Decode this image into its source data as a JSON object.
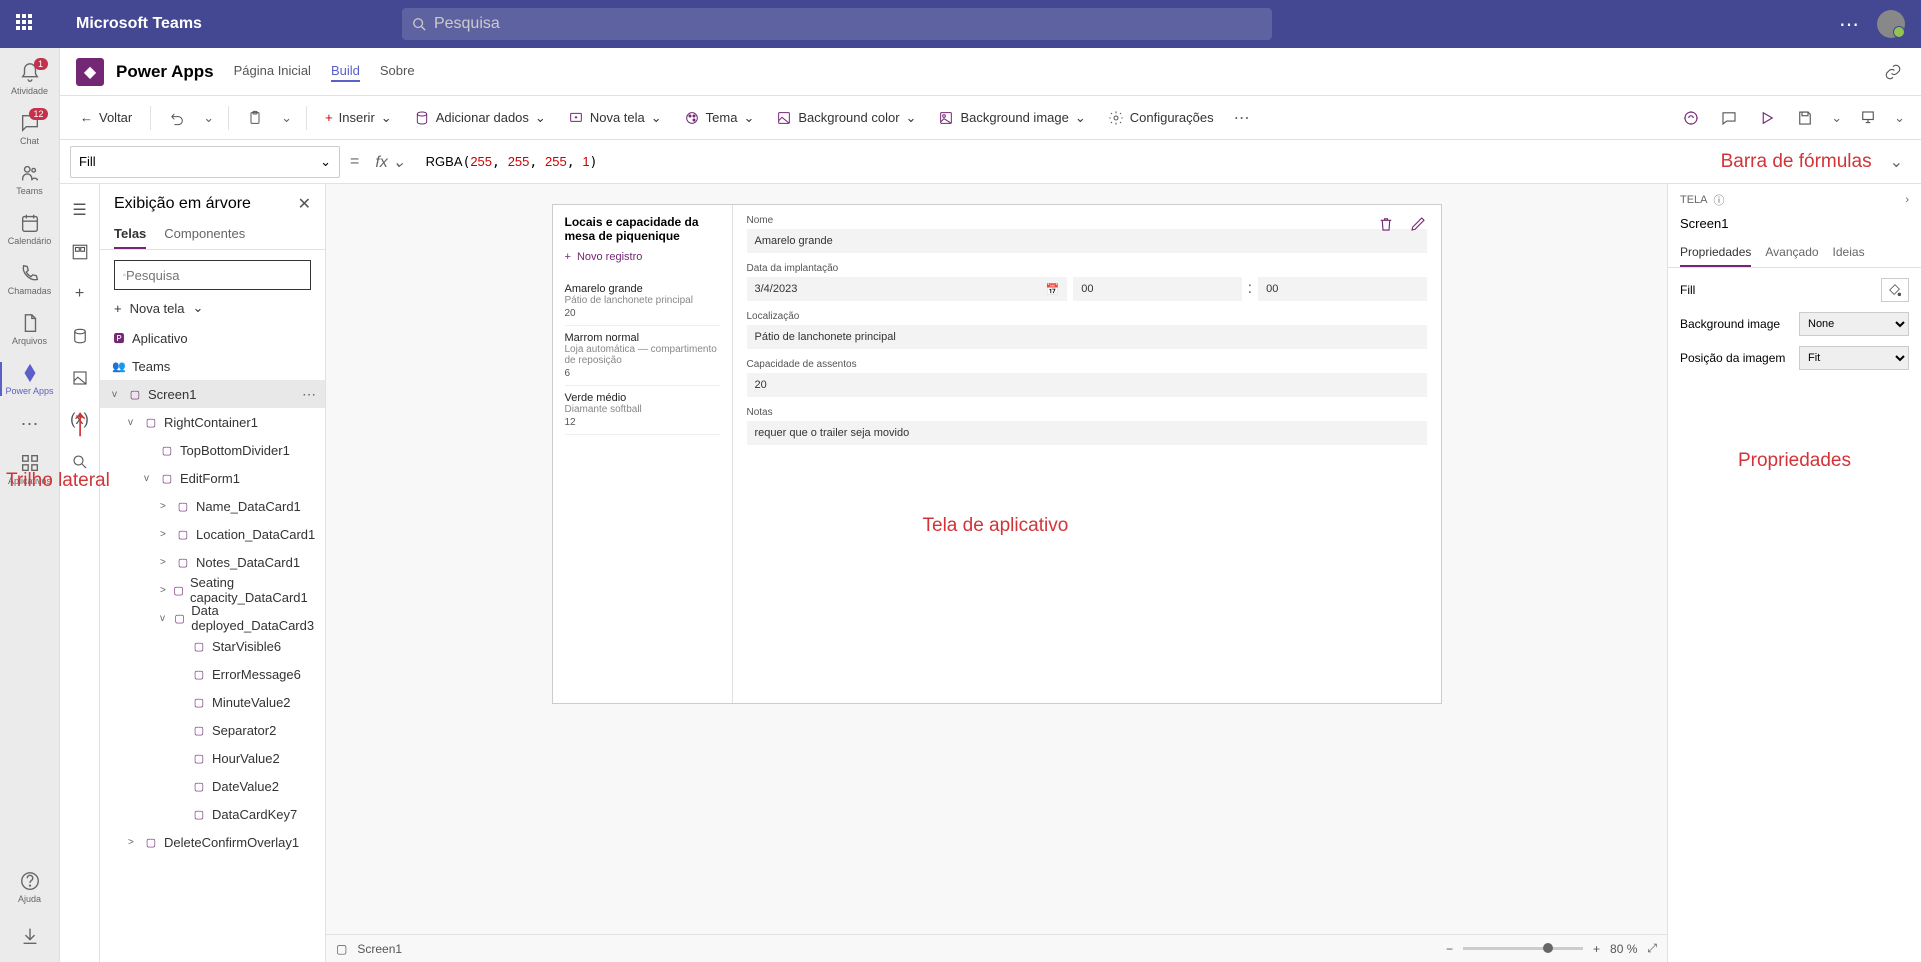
{
  "teams_header": {
    "title": "Microsoft Teams",
    "search_placeholder": "Pesquisa"
  },
  "teams_rail": {
    "items": [
      {
        "label": "Atividade",
        "badge": "1"
      },
      {
        "label": "Chat",
        "badge": "12"
      },
      {
        "label": "Teams"
      },
      {
        "label": "Calendário"
      },
      {
        "label": "Chamadas"
      },
      {
        "label": "Arquivos"
      },
      {
        "label": "Power Apps",
        "active": true
      }
    ],
    "apps": "Aplicativos",
    "help": "Ajuda"
  },
  "app_header": {
    "name": "Power Apps",
    "tabs": [
      {
        "label": "Página Inicial"
      },
      {
        "label": "Build",
        "active": true
      },
      {
        "label": "Sobre"
      }
    ]
  },
  "toolbar": {
    "back": "Voltar",
    "insert": "Inserir",
    "add_data": "Adicionar dados",
    "new_screen": "Nova tela",
    "theme": "Tema",
    "bgcolor": "Background color",
    "bgimage": "Background image",
    "settings": "Configurações"
  },
  "formula_bar": {
    "property": "Fill",
    "fx": "fx",
    "formula_fn": "RGBA",
    "formula_args": "255, 255, 255, 1",
    "annotation": "Barra de fórmulas"
  },
  "tree": {
    "title": "Exibição em árvore",
    "tabs": {
      "screens": "Telas",
      "components": "Componentes"
    },
    "search": "Pesquisa",
    "new_screen": "Nova tela",
    "app": "Aplicativo",
    "teams": "Teams",
    "nodes": [
      {
        "name": "Screen1",
        "level": 0,
        "sel": true,
        "toggle": "v",
        "more": true
      },
      {
        "name": "RightContainer1",
        "level": 1,
        "toggle": "v"
      },
      {
        "name": "TopBottomDivider1",
        "level": 2
      },
      {
        "name": "EditForm1",
        "level": 2,
        "toggle": "v"
      },
      {
        "name": "Name_DataCard1",
        "level": 3,
        "toggle": ">"
      },
      {
        "name": "Location_DataCard1",
        "level": 3,
        "toggle": ">"
      },
      {
        "name": "Notes_DataCard1",
        "level": 3,
        "toggle": ">"
      },
      {
        "name": "Seating capacity_DataCard1",
        "level": 3,
        "toggle": ">"
      },
      {
        "name": "Data deployed_DataCard3",
        "level": 3,
        "toggle": "v"
      },
      {
        "name": "StarVisible6",
        "level": 4
      },
      {
        "name": "ErrorMessage6",
        "level": 4
      },
      {
        "name": "MinuteValue2",
        "level": 4
      },
      {
        "name": "Separator2",
        "level": 4
      },
      {
        "name": "HourValue2",
        "level": 4
      },
      {
        "name": "DateValue2",
        "level": 4
      },
      {
        "name": "DataCardKey7",
        "level": 4
      },
      {
        "name": "DeleteConfirmOverlay1",
        "level": 1,
        "toggle": ">"
      }
    ]
  },
  "canvas": {
    "list_title": "Locais e capacidade da mesa de piquenique",
    "new_record": "Novo registro",
    "items": [
      {
        "name": "Amarelo grande",
        "sub": "Pátio de lanchonete principal",
        "count": "20"
      },
      {
        "name": "Marrom normal",
        "sub": "Loja automática — compartimento de reposição",
        "count": "6"
      },
      {
        "name": "Verde médio",
        "sub": "Diamante softball",
        "count": "12"
      }
    ],
    "form": {
      "name_label": "Nome",
      "name_value": "Amarelo grande",
      "date_label": "Data da implantação",
      "date_value": "3/4/2023",
      "hour": "00",
      "minute": "00",
      "loc_label": "Localização",
      "loc_value": "Pátio de lanchonete principal",
      "cap_label": "Capacidade de assentos",
      "cap_value": "20",
      "notes_label": "Notas",
      "notes_value": "requer que o trailer seja movido"
    },
    "annotation": "Tela de aplicativo"
  },
  "status": {
    "screen": "Screen1",
    "zoom": "80 %"
  },
  "props": {
    "section": "TELA",
    "name": "Screen1",
    "tabs": {
      "props": "Propriedades",
      "adv": "Avançado",
      "ideas": "Ideias"
    },
    "fill": "Fill",
    "bgimage": "Background image",
    "bgimage_val": "None",
    "imgpos": "Posição da imagem",
    "imgpos_val": "Fit",
    "annotation": "Propriedades"
  },
  "side_annotation": "Trilho lateral"
}
